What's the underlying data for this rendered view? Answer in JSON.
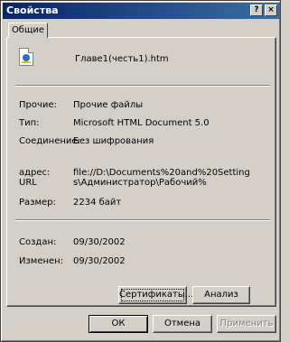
{
  "window": {
    "title": "Свойства",
    "help_glyph": "?",
    "close_glyph": "×"
  },
  "tab": {
    "label": "Общие"
  },
  "file": {
    "name": "Главе1(честь1).htm",
    "icon": "html-document-icon"
  },
  "fields": {
    "opens_with": {
      "label": "Прочие:",
      "value": "Прочие файлы"
    },
    "type": {
      "label": "Тип:",
      "value": "Microsoft HTML Document 5.0"
    },
    "connection": {
      "label": "Соединение:",
      "value": "Без шифрования"
    },
    "address": {
      "label_line1": "адрес:",
      "label_line2": "URL",
      "value": "file://D:\\Documents%20and%20Settings\\Администратор\\Рабочий%"
    },
    "size": {
      "label": "Размер:",
      "value": "2234 байт"
    },
    "created": {
      "label": "Создан:",
      "value": "09/30/2002"
    },
    "modified": {
      "label": "Изменен:",
      "value": "09/30/2002"
    }
  },
  "buttons": {
    "certificates": "Сертификаты...",
    "analyze": "Анализ",
    "ok": "ОК",
    "cancel": "Отмена",
    "apply": "Применить"
  }
}
